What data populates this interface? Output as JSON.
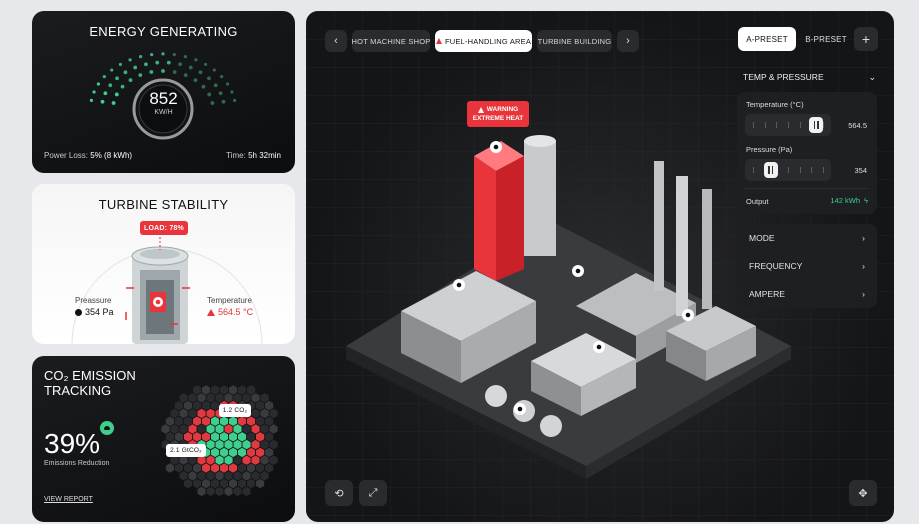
{
  "energy": {
    "title": "ENERGY GENERATING",
    "value": "852",
    "unit": "KW/H",
    "power_loss_label": "Power Loss:",
    "power_loss_value": "5% (8 kWh)",
    "time_label": "Time:",
    "time_value": "5h 32min"
  },
  "turbine": {
    "title": "TURBINE STABILITY",
    "load": "LOAD: 78%",
    "pressure_label": "Preassure",
    "pressure_value": "354 Pa",
    "temperature_label": "Temperature",
    "temperature_value": "564.5 °C"
  },
  "co2": {
    "title_line1": "CO₂ EMISSION",
    "title_line2": "TRACKING",
    "percent": "39%",
    "percent_label": "Emissions Reduction",
    "tag1": "1.2 CO₂",
    "tag2": "2.1 GtCO₂",
    "link": "VIEW REPORT"
  },
  "nav": {
    "tabs": [
      "HOT MACHINE SHOP",
      "FUEL-HANDLING AREA",
      "TURBINE BUILDING"
    ],
    "active_tab": 1,
    "prev_icon": "chevron-left-icon",
    "next_icon": "chevron-right-icon"
  },
  "presets": {
    "a": "A-PRESET",
    "b": "B-PRESET",
    "add": "+"
  },
  "warning": {
    "line1": "WARNING",
    "line2": "EXTREME HEAT"
  },
  "controls": {
    "section_title": "TEMP & PRESSURE",
    "temperature_label": "Temperature (°C)",
    "temperature_value": "564.5",
    "temperature_level": 0.89,
    "pressure_label": "Pressure (Pa)",
    "pressure_value": "354",
    "pressure_level": 0.26,
    "output_label": "Output",
    "output_value": "142 kWh"
  },
  "menu": [
    "MODE",
    "FREQUENCY",
    "AMPERE"
  ],
  "colors": {
    "accent_green": "#3ecf8e",
    "warning_red": "#e8343a",
    "dark_bg": "#111214"
  }
}
